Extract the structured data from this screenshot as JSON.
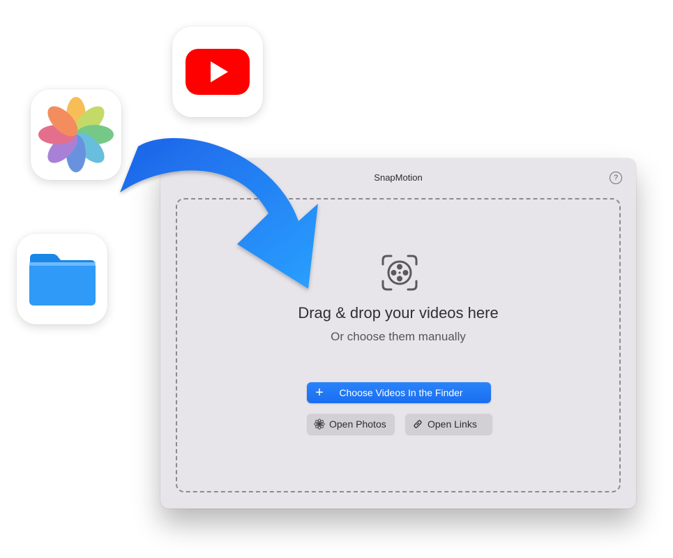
{
  "window": {
    "title": "SnapMotion",
    "help_label": "?"
  },
  "dropzone": {
    "title": "Drag & drop your videos here",
    "subtitle": "Or choose them manually",
    "icon": "film-reel-icon"
  },
  "buttons": {
    "choose_prefix": "+",
    "choose_label": "Choose Videos In the Finder",
    "open_photos_label": "Open Photos",
    "open_links_label": "Open Links"
  },
  "app_icons": [
    "youtube-icon",
    "photos-icon",
    "files-folder-icon"
  ],
  "colors": {
    "accent": "#1a6ef0",
    "arrow": "#1f7ff2",
    "youtube": "#ff0000",
    "window_bg": "#e7e5ea"
  }
}
